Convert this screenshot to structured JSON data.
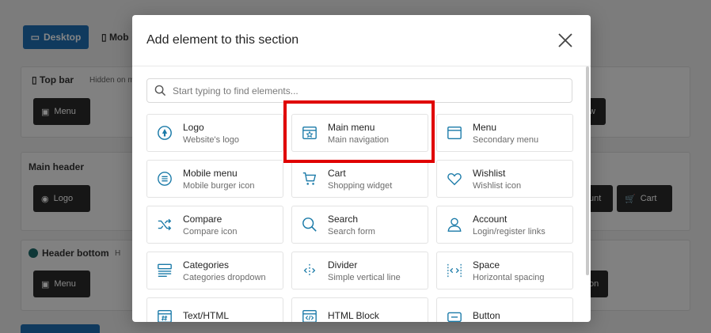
{
  "background": {
    "desktop_button": "Desktop",
    "mobile_tab": "Mob",
    "top_bar": {
      "title": "Top bar",
      "sub": "Hidden on m",
      "chip": "Menu",
      "chip_right": "w"
    },
    "main_header": {
      "title": "Main header",
      "chip": "Logo",
      "chip_account": "unt",
      "chip_cart": "Cart"
    },
    "header_bottom": {
      "title": "Header bottom",
      "sub": "H",
      "chip": "Menu",
      "chip_right": "on"
    }
  },
  "modal": {
    "title": "Add element to this section",
    "search_placeholder": "Start typing to find elements...",
    "elements": [
      {
        "name": "Logo",
        "desc": "Website's logo",
        "icon": "logo-icon"
      },
      {
        "name": "Main menu",
        "desc": "Main navigation",
        "icon": "main-menu-icon"
      },
      {
        "name": "Menu",
        "desc": "Secondary menu",
        "icon": "menu-icon"
      },
      {
        "name": "Mobile menu",
        "desc": "Mobile burger icon",
        "icon": "mobile-menu-icon"
      },
      {
        "name": "Cart",
        "desc": "Shopping widget",
        "icon": "cart-icon"
      },
      {
        "name": "Wishlist",
        "desc": "Wishlist icon",
        "icon": "heart-icon"
      },
      {
        "name": "Compare",
        "desc": "Compare icon",
        "icon": "shuffle-icon"
      },
      {
        "name": "Search",
        "desc": "Search form",
        "icon": "search-icon"
      },
      {
        "name": "Account",
        "desc": "Login/register links",
        "icon": "user-icon"
      },
      {
        "name": "Categories",
        "desc": "Categories dropdown",
        "icon": "categories-icon"
      },
      {
        "name": "Divider",
        "desc": "Simple vertical line",
        "icon": "divider-icon"
      },
      {
        "name": "Space",
        "desc": "Horizontal spacing",
        "icon": "space-icon"
      },
      {
        "name": "Text/HTML",
        "desc": "",
        "icon": "text-html-icon"
      },
      {
        "name": "HTML Block",
        "desc": "",
        "icon": "code-icon"
      },
      {
        "name": "Button",
        "desc": "",
        "icon": "button-icon"
      }
    ]
  },
  "colors": {
    "accent": "#1a7aa8",
    "highlight": "#e00000",
    "primary_button": "#1f6fb5"
  }
}
